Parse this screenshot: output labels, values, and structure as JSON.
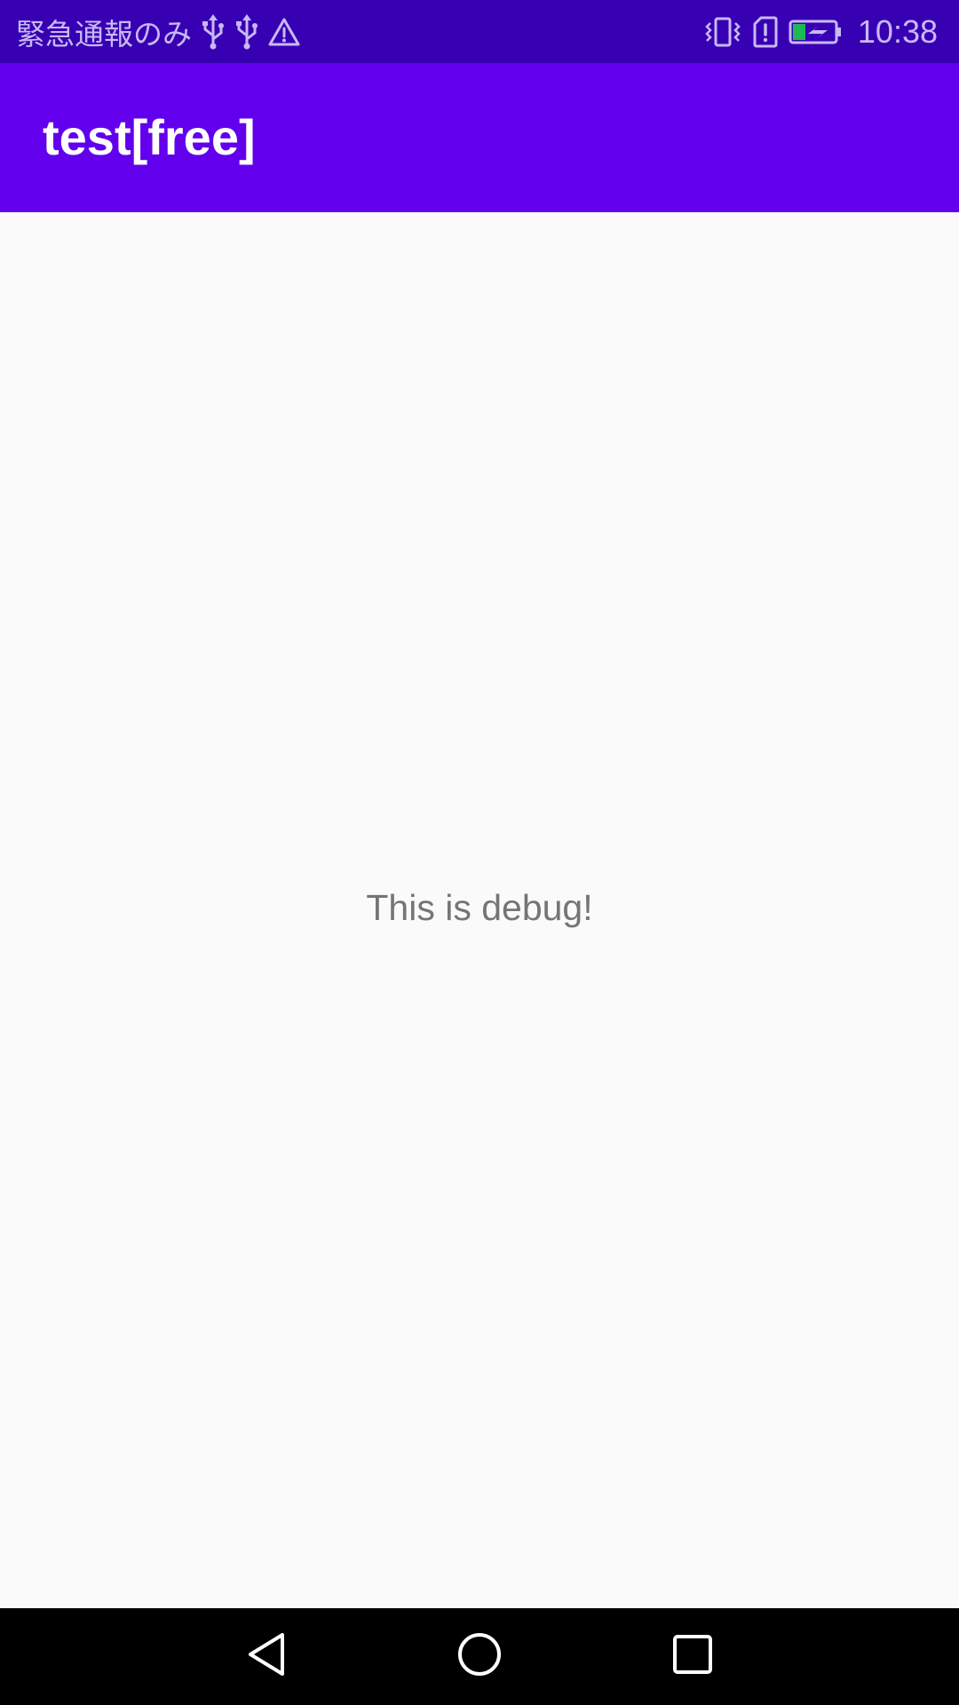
{
  "status_bar": {
    "carrier_text": "緊急通報のみ",
    "time": "10:38",
    "icons": [
      "usb-icon",
      "usb-icon",
      "warning-icon",
      "vibrate-icon",
      "sim-alert-icon",
      "battery-charging-icon"
    ],
    "battery_accent": "#1db954"
  },
  "app_bar": {
    "title": "test[free]",
    "color": "#6200ee"
  },
  "content": {
    "message": "This is debug!"
  },
  "nav_bar": {
    "buttons": [
      "back",
      "home",
      "recents"
    ]
  },
  "colors": {
    "status_bar": "#3700b3",
    "app_bar": "#6200ee",
    "background": "#fafafa",
    "nav_bar": "#000000"
  }
}
